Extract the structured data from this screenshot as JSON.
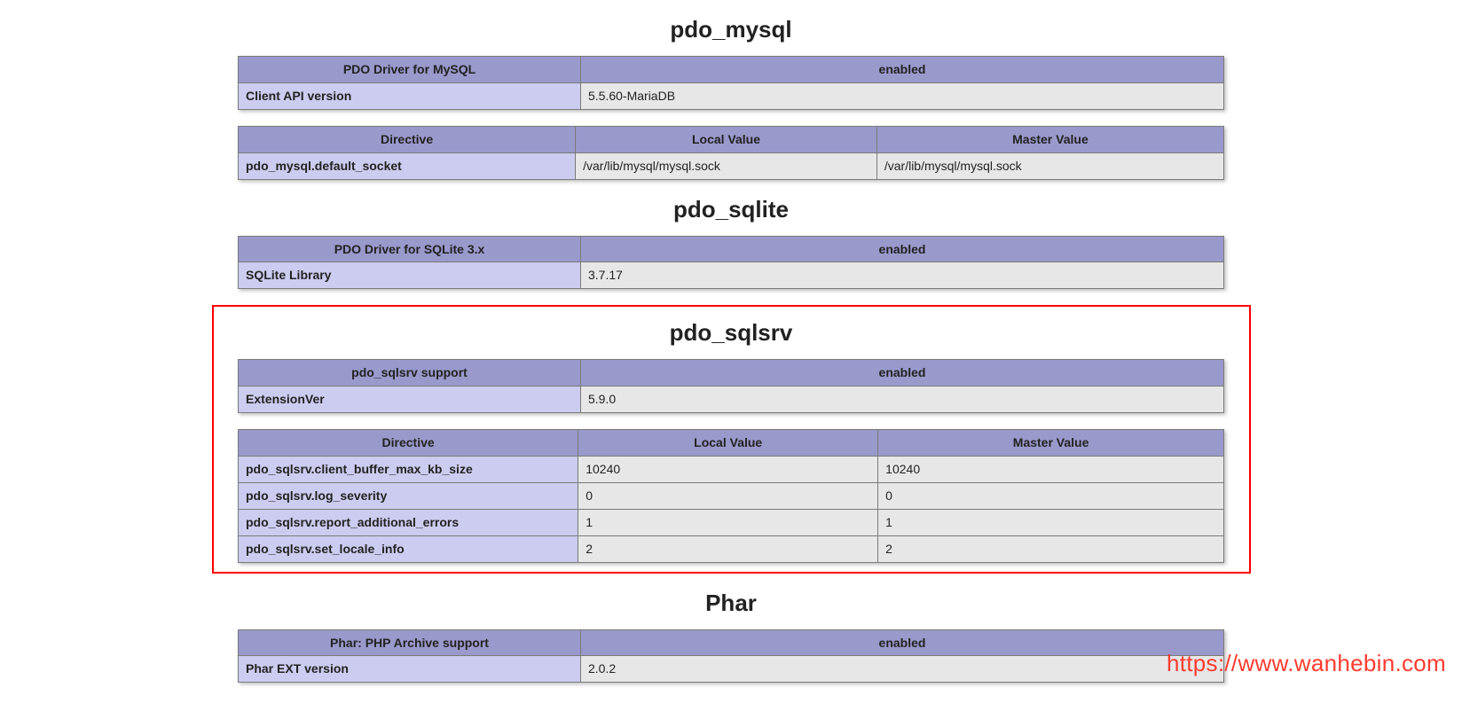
{
  "pdo_mysql": {
    "title": "pdo_mysql",
    "header1": {
      "left": "PDO Driver for MySQL",
      "right": "enabled"
    },
    "rows1": [
      {
        "key": "Client API version",
        "val": "5.5.60-MariaDB"
      }
    ],
    "dir_headers": {
      "c1": "Directive",
      "c2": "Local Value",
      "c3": "Master Value"
    },
    "dir_rows": [
      {
        "key": "pdo_mysql.default_socket",
        "local": "/var/lib/mysql/mysql.sock",
        "master": "/var/lib/mysql/mysql.sock"
      }
    ]
  },
  "pdo_sqlite": {
    "title": "pdo_sqlite",
    "header1": {
      "left": "PDO Driver for SQLite 3.x",
      "right": "enabled"
    },
    "rows1": [
      {
        "key": "SQLite Library",
        "val": "3.7.17"
      }
    ]
  },
  "pdo_sqlsrv": {
    "title": "pdo_sqlsrv",
    "header1": {
      "left": "pdo_sqlsrv support",
      "right": "enabled"
    },
    "rows1": [
      {
        "key": "ExtensionVer",
        "val": "5.9.0"
      }
    ],
    "dir_headers": {
      "c1": "Directive",
      "c2": "Local Value",
      "c3": "Master Value"
    },
    "dir_rows": [
      {
        "key": "pdo_sqlsrv.client_buffer_max_kb_size",
        "local": "10240",
        "master": "10240"
      },
      {
        "key": "pdo_sqlsrv.log_severity",
        "local": "0",
        "master": "0"
      },
      {
        "key": "pdo_sqlsrv.report_additional_errors",
        "local": "1",
        "master": "1"
      },
      {
        "key": "pdo_sqlsrv.set_locale_info",
        "local": "2",
        "master": "2"
      }
    ]
  },
  "phar": {
    "title": "Phar",
    "header1": {
      "left": "Phar: PHP Archive support",
      "right": "enabled"
    },
    "rows1": [
      {
        "key": "Phar EXT version",
        "val": "2.0.2"
      }
    ]
  },
  "watermark": "https://www.wanhebin.com"
}
